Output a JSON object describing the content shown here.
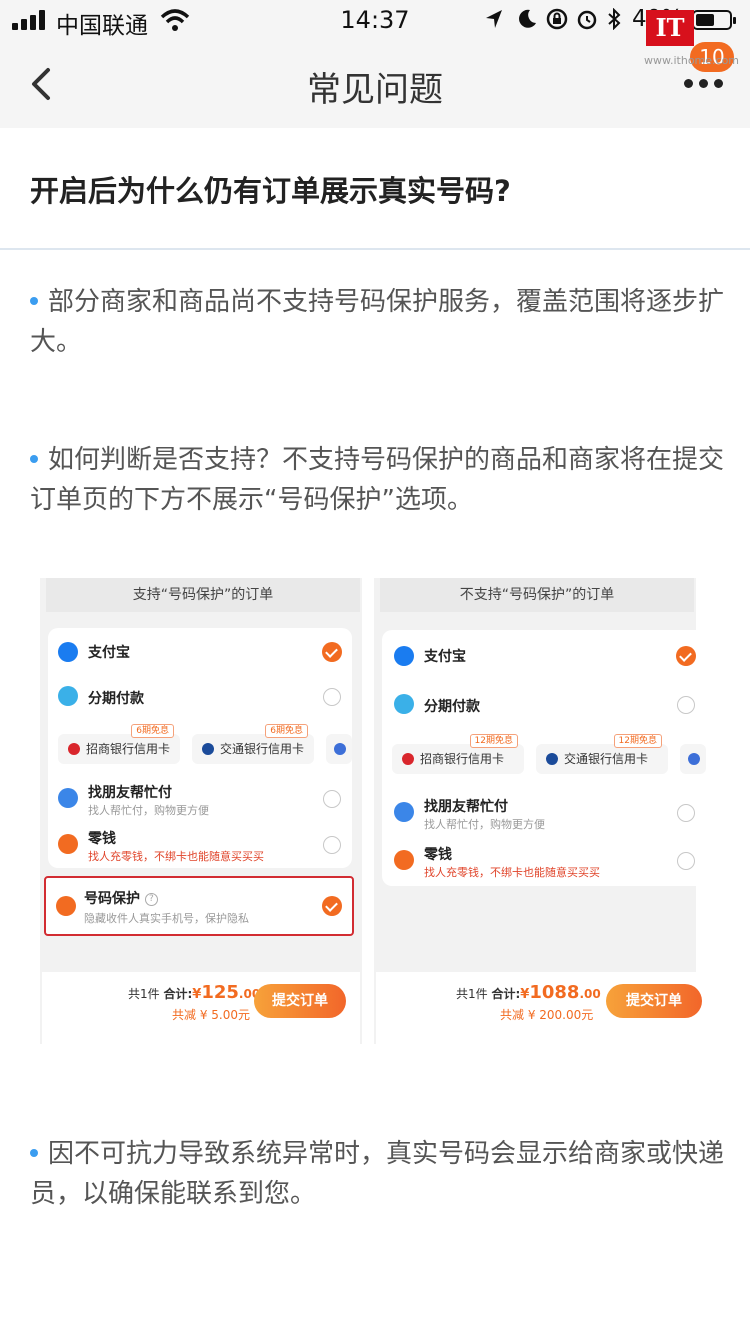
{
  "status_bar": {
    "carrier": "中国联通",
    "time": "14:37",
    "battery_percent": "40%"
  },
  "nav": {
    "title": "常见问题"
  },
  "watermark": {
    "logo": "IT",
    "badge": "10",
    "url": "www.ithome.com"
  },
  "faq": {
    "question": "开启后为什么仍有订单展示真实号码?",
    "paragraphs": [
      "部分商家和商品尚不支持号码保护服务，覆盖范围将逐步扩大。",
      "如何判断是否支持？不支持号码保护的商品和商家将在提交订单页的下方不展示“号码保护”选项。",
      "因不可抗力导致系统异常时，真实号码会显示给商家或快递员，以确保能联系到您。"
    ]
  },
  "illustration": {
    "left": {
      "header": "支持“号码保护”的订单",
      "alipay": "支付宝",
      "installment": "分期付款",
      "bank1": "招商银行信用卡",
      "bank1_badge": "6期免息",
      "bank2": "交通银行信用卡",
      "bank2_badge": "6期免息",
      "friend_pay": "找朋友帮忙付",
      "friend_pay_sub": "找人帮忙付，购物更方便",
      "change": "零钱",
      "change_sub": "找人充零钱，不绑卡也能随意买买买",
      "number_protect": "号码保护",
      "number_protect_sub": "隐藏收件人真实手机号，保护隐私",
      "count_text": "共1件",
      "total_label": "合计:",
      "currency": "¥",
      "total_int": "125",
      "total_dec": ".00",
      "saving": "共减 ¥ 5.00元",
      "submit": "提交订单"
    },
    "right": {
      "header": "不支持“号码保护”的订单",
      "alipay": "支付宝",
      "installment": "分期付款",
      "bank1": "招商银行信用卡",
      "bank1_badge": "12期免息",
      "bank2": "交通银行信用卡",
      "bank2_badge": "12期免息",
      "friend_pay": "找朋友帮忙付",
      "friend_pay_sub": "找人帮忙付，购物更方便",
      "change": "零钱",
      "change_sub": "找人充零钱，不绑卡也能随意买买买",
      "count_text": "共1件",
      "total_label": "合计:",
      "currency": "¥",
      "total_int": "1088",
      "total_dec": ".00",
      "saving": "共减 ¥ 200.00元",
      "submit": "提交订单"
    }
  },
  "colors": {
    "accent": "#f26b21",
    "bullet": "#3b9df0",
    "highlight_border": "#d22c32"
  }
}
